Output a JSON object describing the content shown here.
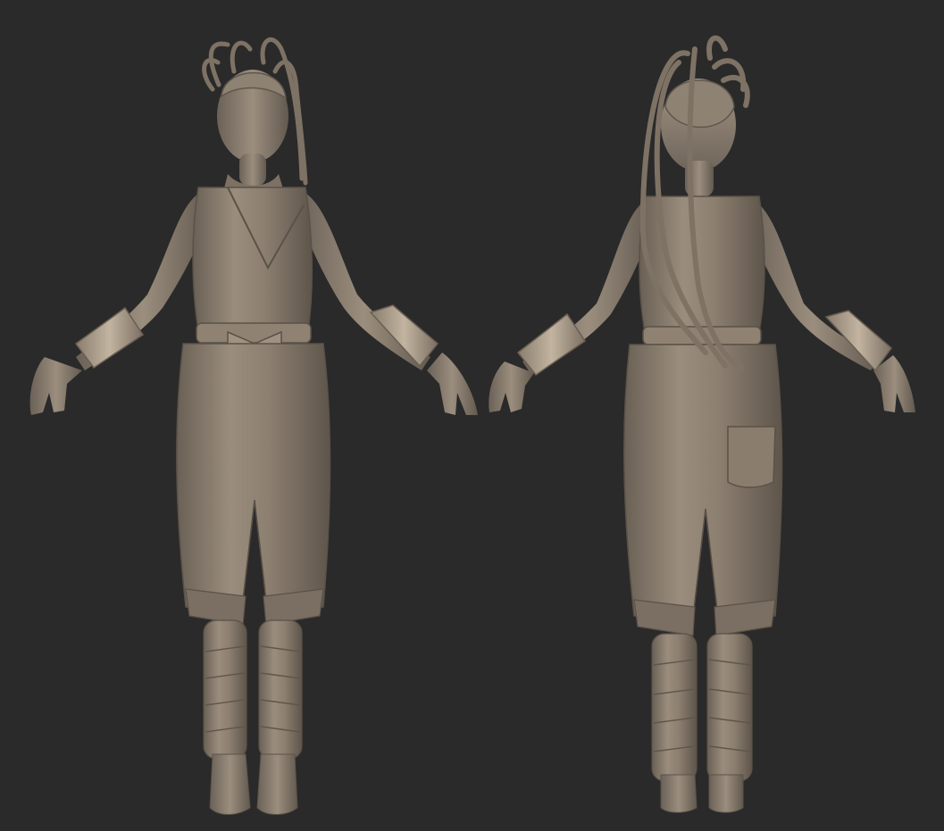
{
  "viewport": {
    "background": "#2a2a2a",
    "material_base": "#8c7f70",
    "material_shadow": "#5e554b",
    "material_highlight": "#b3a695",
    "material_edge": "#d6c8b4"
  },
  "figures": [
    {
      "view": "front"
    },
    {
      "view": "back"
    }
  ]
}
